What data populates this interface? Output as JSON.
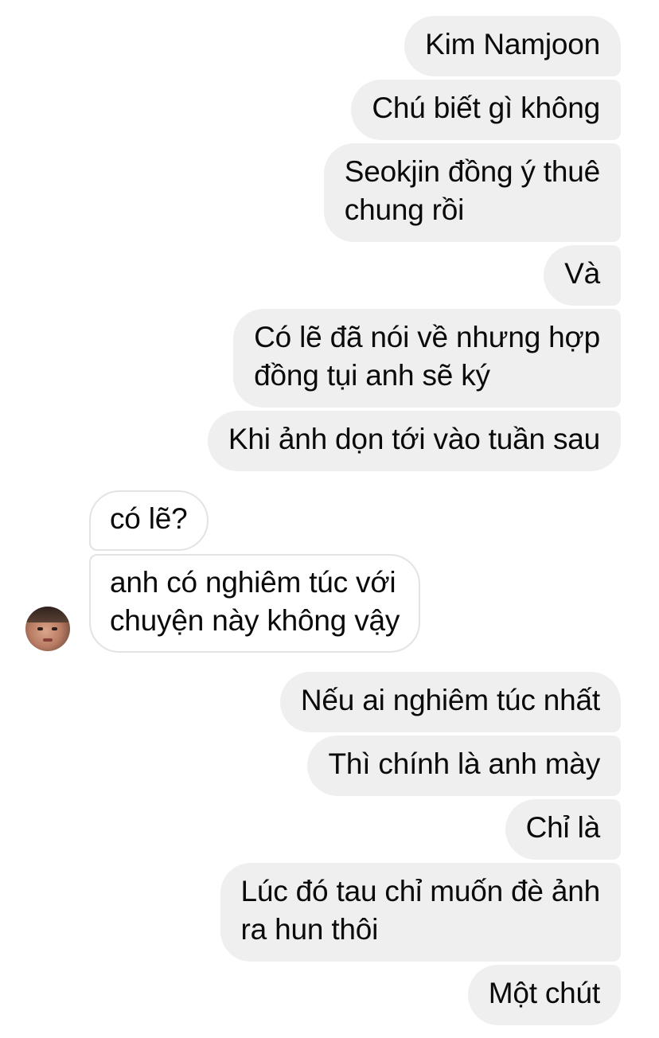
{
  "messages": [
    {
      "id": "m1",
      "side": "outgoing",
      "lines": [
        "Kim Namjoon"
      ]
    },
    {
      "id": "m2",
      "side": "outgoing",
      "lines": [
        "Chú biết gì không"
      ]
    },
    {
      "id": "m3",
      "side": "outgoing",
      "lines": [
        "Seokjin đồng ý thuê",
        "chung rồi"
      ]
    },
    {
      "id": "m4",
      "side": "outgoing",
      "lines": [
        "Và"
      ]
    },
    {
      "id": "m5",
      "side": "outgoing",
      "lines": [
        "Có lẽ đã nói về nhưng hợp",
        "đồng tụi anh sẽ ký"
      ]
    },
    {
      "id": "m6",
      "side": "outgoing",
      "lines": [
        "Khi ảnh dọn tới vào tuần sau"
      ]
    },
    {
      "id": "m7",
      "side": "incoming",
      "lines": [
        "có lẽ?"
      ]
    },
    {
      "id": "m8",
      "side": "incoming",
      "lines": [
        "anh có nghiêm túc với",
        "chuyện này không vậy"
      ]
    },
    {
      "id": "m9",
      "side": "outgoing",
      "lines": [
        "Nếu ai nghiêm túc nhất"
      ]
    },
    {
      "id": "m10",
      "side": "outgoing",
      "lines": [
        "Thì chính là anh mày"
      ]
    },
    {
      "id": "m11",
      "side": "outgoing",
      "lines": [
        "Chỉ là"
      ]
    },
    {
      "id": "m12",
      "side": "outgoing",
      "lines": [
        "Lúc đó tau chỉ muốn đè ảnh",
        "ra hun thôi"
      ]
    },
    {
      "id": "m13",
      "side": "outgoing",
      "lines": [
        "Một chút"
      ]
    }
  ],
  "colors": {
    "outgoing_bubble": "#efefef",
    "incoming_bubble": "#ffffff",
    "incoming_border": "#e3e3e3",
    "text": "#0a0a0a"
  },
  "avatar": {
    "icon": "contact-avatar"
  }
}
